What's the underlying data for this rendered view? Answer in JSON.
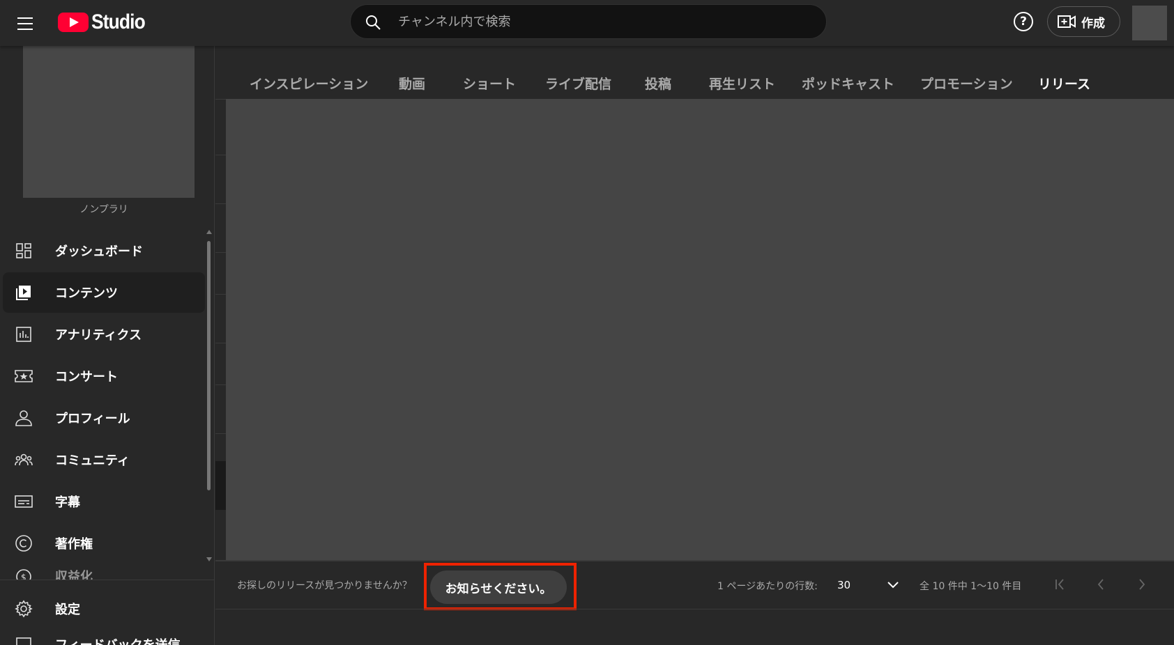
{
  "header": {
    "logo_text": "Studio",
    "search_placeholder": "チャンネル内で検索",
    "help_label": "?",
    "create_label": "作成"
  },
  "sidebar": {
    "channel_name": "ノンプラリ",
    "items": [
      {
        "label": "ダッシュボード",
        "icon": "dashboard-icon"
      },
      {
        "label": "コンテンツ",
        "icon": "content-icon",
        "active": true
      },
      {
        "label": "アナリティクス",
        "icon": "analytics-icon"
      },
      {
        "label": "コンサート",
        "icon": "ticket-icon"
      },
      {
        "label": "プロフィール",
        "icon": "profile-icon"
      },
      {
        "label": "コミュニティ",
        "icon": "community-icon"
      },
      {
        "label": "字幕",
        "icon": "subtitles-icon"
      },
      {
        "label": "著作権",
        "icon": "copyright-icon"
      },
      {
        "label": "収益化",
        "icon": "monetization-icon"
      }
    ],
    "settings_label": "設定",
    "feedback_label": "フィードバックを送信"
  },
  "tabs": [
    {
      "label": "インスピレーション"
    },
    {
      "label": "動画"
    },
    {
      "label": "ショート"
    },
    {
      "label": "ライブ配信"
    },
    {
      "label": "投稿"
    },
    {
      "label": "再生リスト"
    },
    {
      "label": "ポッドキャスト"
    },
    {
      "label": "プロモーション"
    },
    {
      "label": "リリース",
      "active": true
    }
  ],
  "footer": {
    "not_found_text": "お探しのリリースが見つかりませんか？",
    "feedback_button": "お知らせください。",
    "rows_per_page_label": "1 ページあたりの行数:",
    "rows_per_page_value": "30",
    "range_text": "全 10 件中 1〜10 件目"
  },
  "colors": {
    "accent_red": "#ff0033",
    "highlight_border": "#ee2200",
    "background": "#282828",
    "content_placeholder": "#454545"
  }
}
